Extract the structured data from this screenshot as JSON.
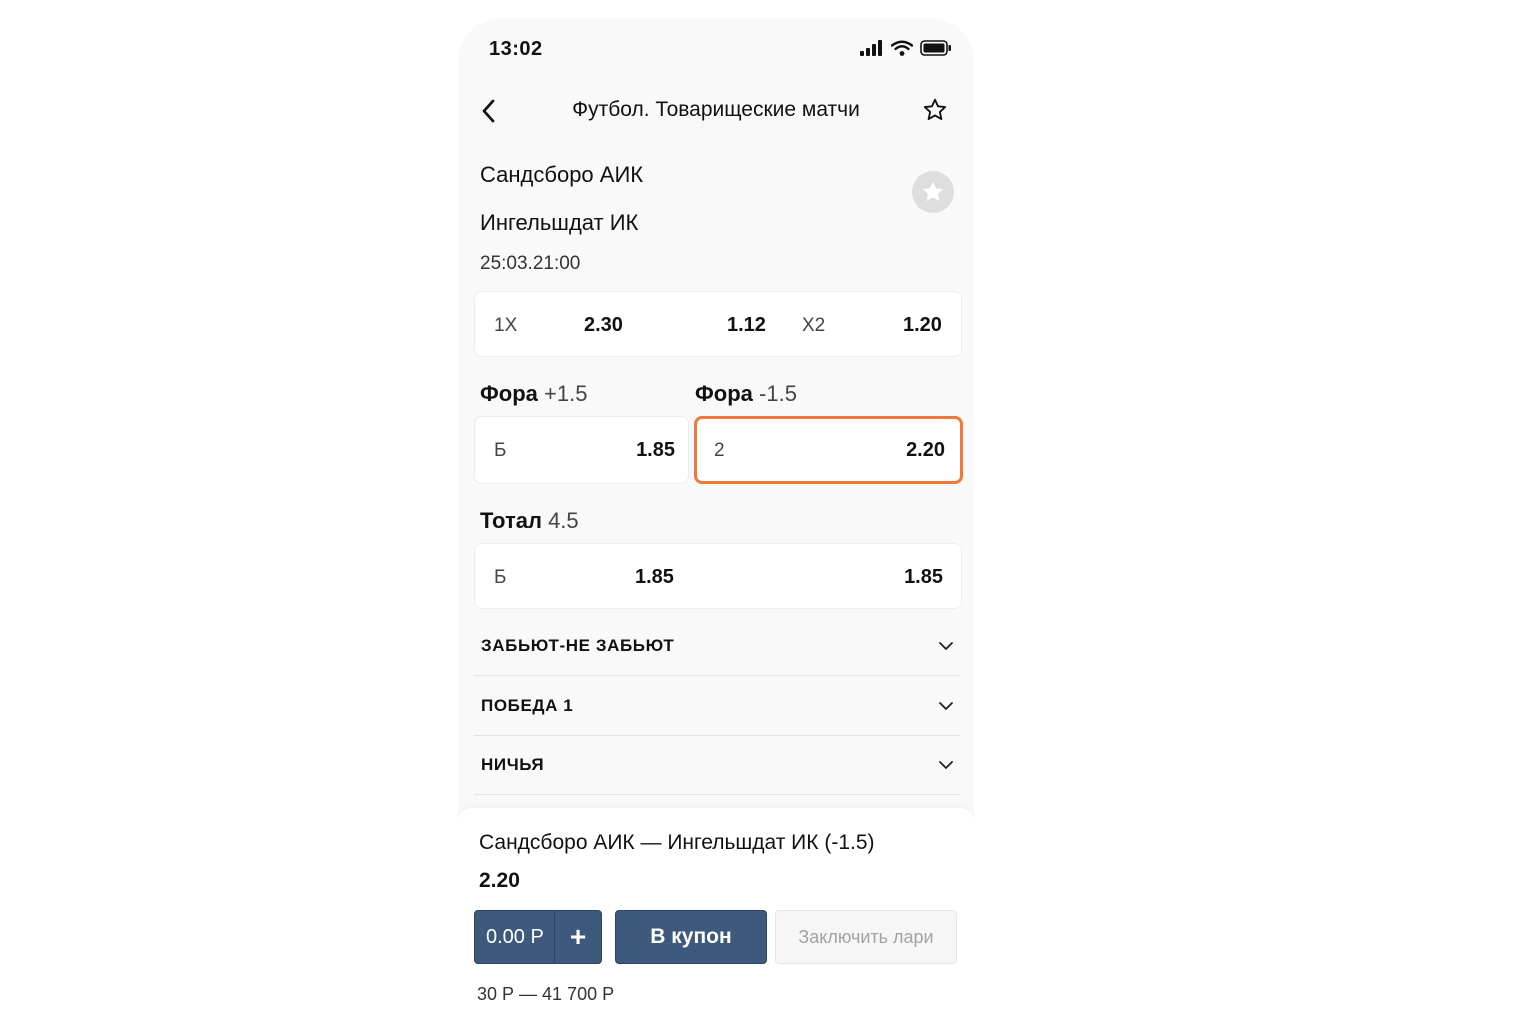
{
  "status_bar": {
    "time": "13:02"
  },
  "header": {
    "title": "Футбол. Товарищеские матчи"
  },
  "match": {
    "team1": "Сандсборо АИК",
    "team2": "Ингельшдат ИК",
    "datetime": "25:03.21:00"
  },
  "double_chance": {
    "label_1x": "1X",
    "value_1x": "2.30",
    "value_12": "1.12",
    "label_x2": "X2",
    "value_x2": "1.20"
  },
  "handicap_plus": {
    "title": "Фора",
    "line": "+1.5",
    "label": "Б",
    "value": "1.85"
  },
  "handicap_minus": {
    "title": "Фора",
    "line": "-1.5",
    "label": "2",
    "value": "2.20",
    "selected": true,
    "highlight_color": "#f0783a"
  },
  "total": {
    "title": "Тотал",
    "line": "4.5",
    "label": "Б",
    "value_over": "1.85",
    "value_under": "1.85"
  },
  "markets": [
    {
      "label": "ЗАБЬЮТ-НЕ ЗАБЬЮТ"
    },
    {
      "label": "ПОБЕДА 1"
    },
    {
      "label": "НИЧЬЯ"
    }
  ],
  "bet_slip": {
    "selection": "Сандсборо АИК — Ингельшдат ИК (-1.5)",
    "odds": "2.20",
    "stake": "0.00 Р",
    "plus": "+",
    "coupon_button": "В купон",
    "place_bet_button": "Заключить лари",
    "limits": "30 Р — 41 700 Р",
    "accent_color": "#3d5a7d"
  },
  "icons": {
    "back": "chevron-left-icon",
    "favorite_header": "star-outline-icon",
    "favorite_match": "star-filled-icon",
    "expand": "chevron-down-icon",
    "signal": "cellular-signal-icon",
    "wifi": "wifi-icon",
    "battery": "battery-icon"
  }
}
